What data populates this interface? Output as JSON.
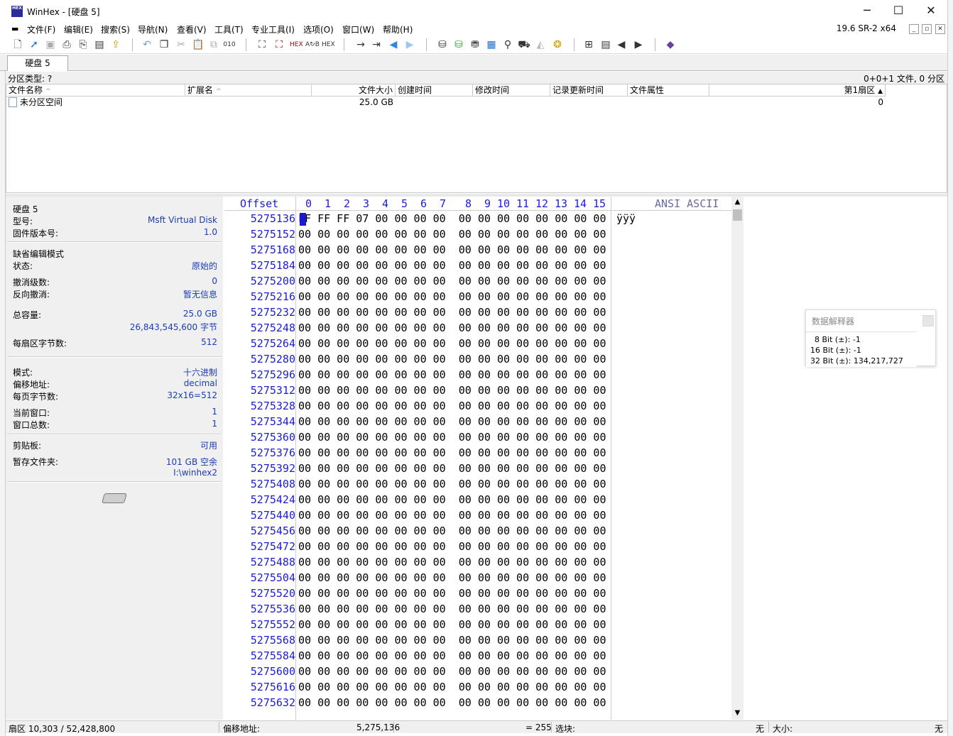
{
  "window": {
    "title": "WinHex - [硬盘 5]",
    "icon_text": "HEX",
    "minimize": "─",
    "maximize": "☐",
    "close": "✕"
  },
  "menu": {
    "items": [
      "文件(F)",
      "编辑(E)",
      "搜索(S)",
      "导航(N)",
      "查看(V)",
      "工具(T)",
      "专业工具(I)",
      "选项(O)",
      "窗口(W)",
      "帮助(H)"
    ],
    "version": "19.6 SR-2 x64",
    "mdi_min": "_",
    "mdi_restore": "▫",
    "mdi_close": "✕"
  },
  "toolbar": {
    "icons": [
      "new-file-icon",
      "open-file-icon",
      "save-icon",
      "print-icon",
      "print-preview-icon",
      "properties-icon",
      "export-icon",
      "undo-icon",
      "copy-icon",
      "cut-icon",
      "paste-icon",
      "paste-special-icon",
      "binary-icon",
      "find-icon",
      "find-hex-icon",
      "find-text-icon",
      "replace-text-icon",
      "replace-hex-icon",
      "goto-icon",
      "goto-offset-icon",
      "back-icon",
      "forward-icon",
      "disk-icon",
      "disk-open-icon",
      "disk-tools-icon",
      "ram-icon",
      "zoom-icon",
      "cleanup-icon",
      "gap-icon",
      "settings-icon",
      "grid-icon",
      "table-icon",
      "prev-icon",
      "next-icon",
      "book-icon"
    ]
  },
  "tabs": [
    {
      "label": "硬盘 5"
    }
  ],
  "partition_bar": {
    "label": "分区类型: ?",
    "summary": "0+0+1 文件, 0 分区"
  },
  "file_list": {
    "columns": [
      "文件名称",
      "扩展名",
      "文件大小",
      "创建时间",
      "修改时间",
      "记录更新时间",
      "文件属性",
      "第1扇区"
    ],
    "rows": [
      {
        "name": "未分区空间",
        "ext": "",
        "size": "25.0 GB",
        "created": "",
        "modified": "",
        "record": "",
        "attr": "",
        "sector": "0"
      }
    ]
  },
  "info": {
    "disk_name": "硬盘 5",
    "model_label": "型号:",
    "model_value": "Msft Virtual Disk",
    "fw_label": "固件版本号:",
    "fw_value": "1.0",
    "edit_mode_label": "缺省编辑模式",
    "state_label": "状态:",
    "state_value": "原始的",
    "undo_label": "撤消级数:",
    "undo_value": "0",
    "redo_label": "反向撤消:",
    "redo_value": "暂无信息",
    "capacity_label": "总容量:",
    "capacity_value": "25.0 GB",
    "capacity_bytes": "26,843,545,600 字节",
    "bps_label": "每扇区字节数:",
    "bps_value": "512",
    "mode_label": "模式:",
    "mode_value": "十六进制",
    "offset_label": "偏移地址:",
    "offset_value": "decimal",
    "bpp_label": "每页字节数:",
    "bpp_value": "32x16=512",
    "curwin_label": "当前窗口:",
    "curwin_value": "1",
    "totalwin_label": "窗口总数:",
    "totalwin_value": "1",
    "clip_label": "剪贴板:",
    "clip_value": "可用",
    "temp_label": "暂存文件夹:",
    "temp_value": "101 GB 空余",
    "temp_path": "I:\\winhex2"
  },
  "hex": {
    "offset_header": "Offset",
    "column_headers": [
      "0",
      "1",
      "2",
      "3",
      "4",
      "5",
      "6",
      "7",
      "8",
      "9",
      "10",
      "11",
      "12",
      "13",
      "14",
      "15"
    ],
    "ascii_header": "ANSI ASCII",
    "ascii_first_row": "ÿÿÿ",
    "offsets": [
      "5275136",
      "5275152",
      "5275168",
      "5275184",
      "5275200",
      "5275216",
      "5275232",
      "5275248",
      "5275264",
      "5275280",
      "5275296",
      "5275312",
      "5275328",
      "5275344",
      "5275360",
      "5275376",
      "5275392",
      "5275408",
      "5275424",
      "5275440",
      "5275456",
      "5275472",
      "5275488",
      "5275504",
      "5275520",
      "5275536",
      "5275552",
      "5275568",
      "5275584",
      "5275600",
      "5275616",
      "5275632"
    ],
    "first_row_bytes": "FF FF FF 07 00 00 00 00  00 00 00 00 00 00 00 00",
    "zero_row_bytes": "00 00 00 00 00 00 00 00  00 00 00 00 00 00 00 00"
  },
  "interpreter": {
    "title": "数据解释器",
    "rows": [
      "8 Bit (±): -1",
      "16 Bit (±): -1",
      "32 Bit (±): 134,217,727"
    ]
  },
  "status": {
    "sector": "扇区 10,303 / 52,428,800",
    "offset_label": "偏移地址:",
    "offset_value": "5,275,136",
    "value": "= 255",
    "selection_label": "选块:",
    "selection_value": "无",
    "size_label": "大小:",
    "size_value": "无"
  }
}
